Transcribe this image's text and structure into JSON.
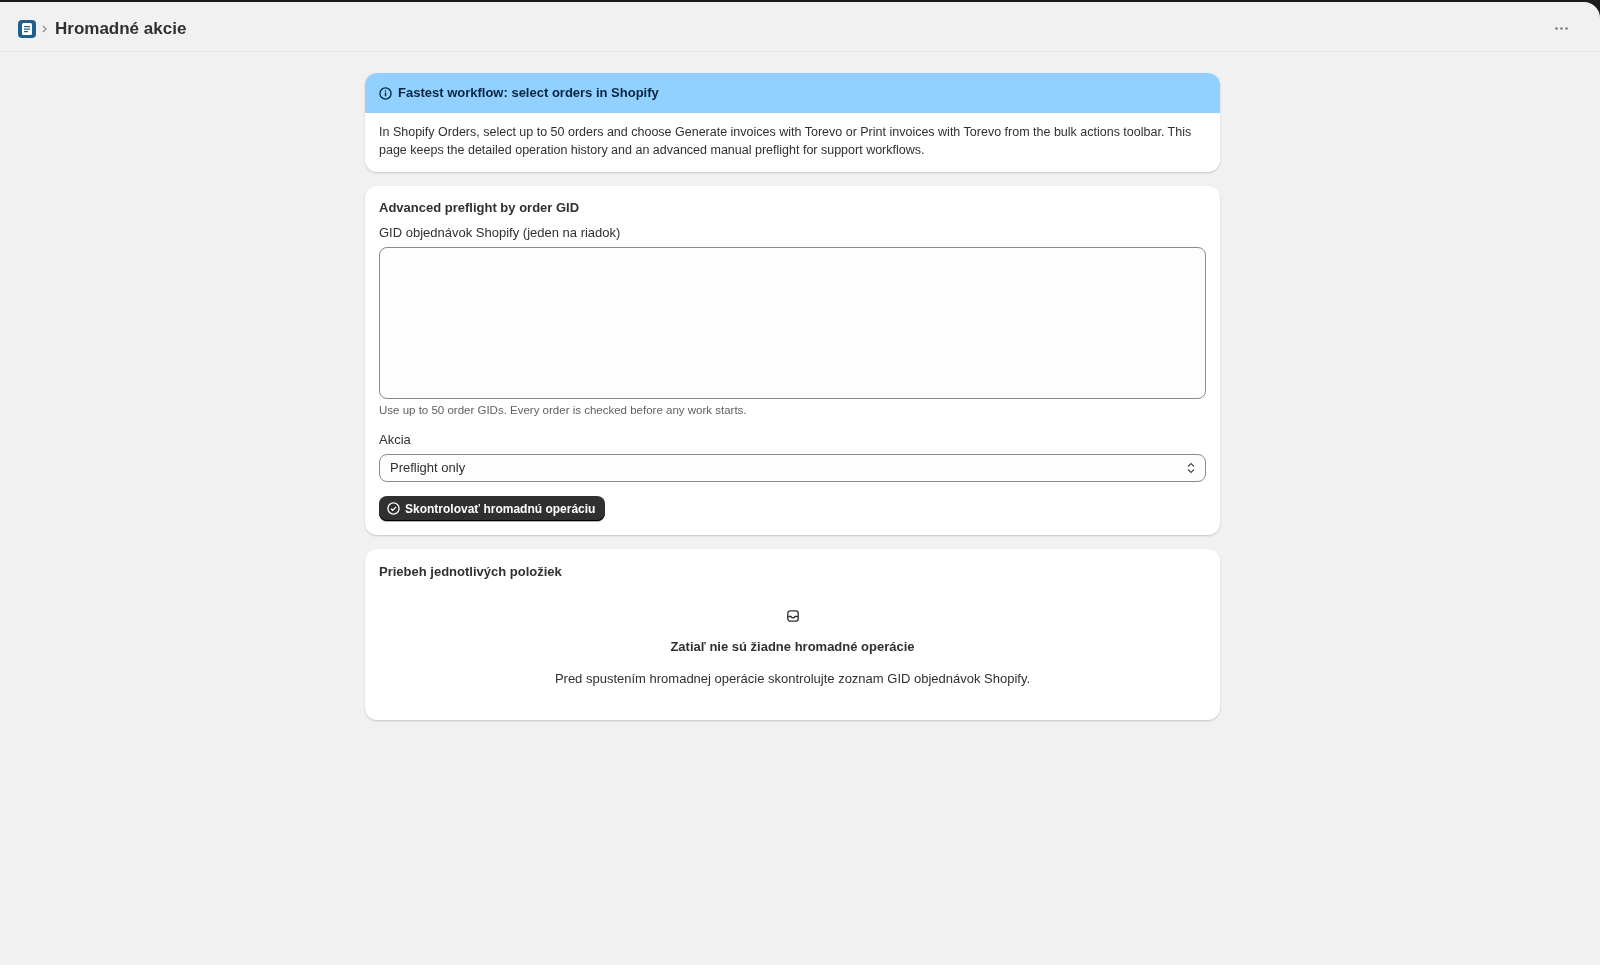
{
  "header": {
    "title": "Hromadné akcie"
  },
  "banner": {
    "title": "Fastest workflow: select orders in Shopify",
    "body": "In Shopify Orders, select up to 50 orders and choose Generate invoices with Torevo or Print invoices with Torevo from the bulk actions toolbar. This page keeps the detailed operation history and an advanced manual preflight for support workflows."
  },
  "preflight_card": {
    "title": "Advanced preflight by order GID",
    "gid_field": {
      "label": "GID objednávok Shopify (jeden na riadok)",
      "help": "Use up to 50 order GIDs. Every order is checked before any work starts."
    },
    "action_select": {
      "label": "Akcia",
      "value": "Preflight only"
    },
    "submit_button": "Skontrolovať hromadnú operáciu"
  },
  "progress_card": {
    "title": "Priebeh jednotlivých položiek",
    "empty_state": {
      "heading": "Zatiaľ nie sú žiadne hromadné operácie",
      "description": "Pred spustením hromadnej operácie skontrolujte zoznam GID objednávok Shopify."
    }
  }
}
